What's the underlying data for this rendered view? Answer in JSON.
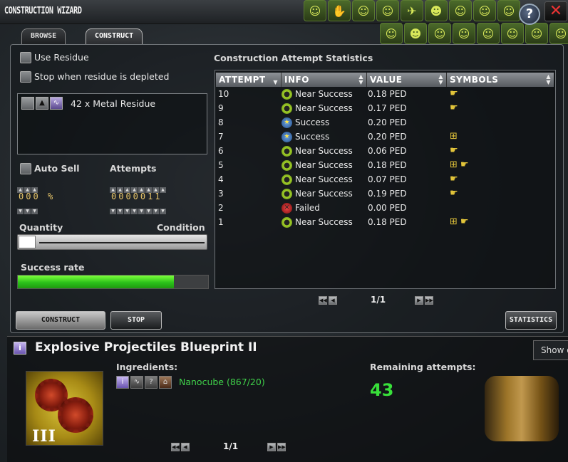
{
  "window": {
    "title": "CONSTRUCTION WIZARD",
    "close_glyph": "✕",
    "help_glyph": "?"
  },
  "emotes": {
    "top": [
      "☺",
      "✋",
      "☺",
      "☺",
      "✈",
      "☻",
      "☺",
      "☺",
      "☺"
    ],
    "bottom": [
      "☺",
      "☻",
      "☺",
      "☺",
      "☺",
      "☺",
      "☺",
      "☺"
    ]
  },
  "tabs": {
    "browse": "BROWSE",
    "construct": "CONSTRUCT"
  },
  "options": {
    "use_residue": "Use Residue",
    "stop_when_depleted": "Stop when residue is depleted",
    "residue_item": "42 x Metal Residue",
    "auto_sell": "Auto Sell",
    "auto_sell_digits": "000",
    "auto_sell_unit": "%",
    "attempts_label": "Attempts",
    "attempts_digits": "0000011",
    "quantity_label": "Quantity",
    "condition_label": "Condition",
    "success_rate_label": "Success rate",
    "success_rate_fill": 0.82
  },
  "buttons": {
    "construct": "CONSTRUCT",
    "stop": "STOP",
    "statistics": "STATISTICS"
  },
  "stats": {
    "heading": "Construction Attempt Statistics",
    "columns": [
      "ATTEMPT",
      "INFO",
      "VALUE",
      "SYMBOLS"
    ],
    "rows": [
      {
        "attempt": "10",
        "status": "near",
        "info": "Near Success",
        "value": "0.18 PED",
        "symbols": [
          "hand-point"
        ]
      },
      {
        "attempt": "9",
        "status": "near",
        "info": "Near Success",
        "value": "0.17 PED",
        "symbols": [
          "hand-point"
        ]
      },
      {
        "attempt": "8",
        "status": "success",
        "info": "Success",
        "value": "0.20 PED",
        "symbols": []
      },
      {
        "attempt": "7",
        "status": "success",
        "info": "Success",
        "value": "0.20 PED",
        "symbols": [
          "blueprint-plus"
        ]
      },
      {
        "attempt": "6",
        "status": "near",
        "info": "Near Success",
        "value": "0.06 PED",
        "symbols": [
          "hand-point"
        ]
      },
      {
        "attempt": "5",
        "status": "near",
        "info": "Near Success",
        "value": "0.18 PED",
        "symbols": [
          "blueprint-plus",
          "hand-point"
        ]
      },
      {
        "attempt": "4",
        "status": "near",
        "info": "Near Success",
        "value": "0.07 PED",
        "symbols": [
          "hand-point"
        ]
      },
      {
        "attempt": "3",
        "status": "near",
        "info": "Near Success",
        "value": "0.19 PED",
        "symbols": [
          "hand-point"
        ]
      },
      {
        "attempt": "2",
        "status": "failed",
        "info": "Failed",
        "value": "0.00 PED",
        "symbols": []
      },
      {
        "attempt": "1",
        "status": "near",
        "info": "Near Success",
        "value": "0.18 PED",
        "symbols": [
          "blueprint-plus",
          "hand-point"
        ]
      }
    ],
    "page": "1/1"
  },
  "blueprint": {
    "title": "Explosive Projectiles Blueprint II",
    "image_numeral": "III",
    "ingredients_label": "Ingredients:",
    "ingredient": "Nanocube (867/20)",
    "remaining_label": "Remaining attempts:",
    "remaining_value": "43",
    "page": "1/1",
    "tooltip": "Show o"
  },
  "colors": {
    "success_bar": "#3ad61f",
    "remaining_value": "#38e03a",
    "ingredient_text": "#3fd04a",
    "symbol_gold": "#e2c43a"
  }
}
